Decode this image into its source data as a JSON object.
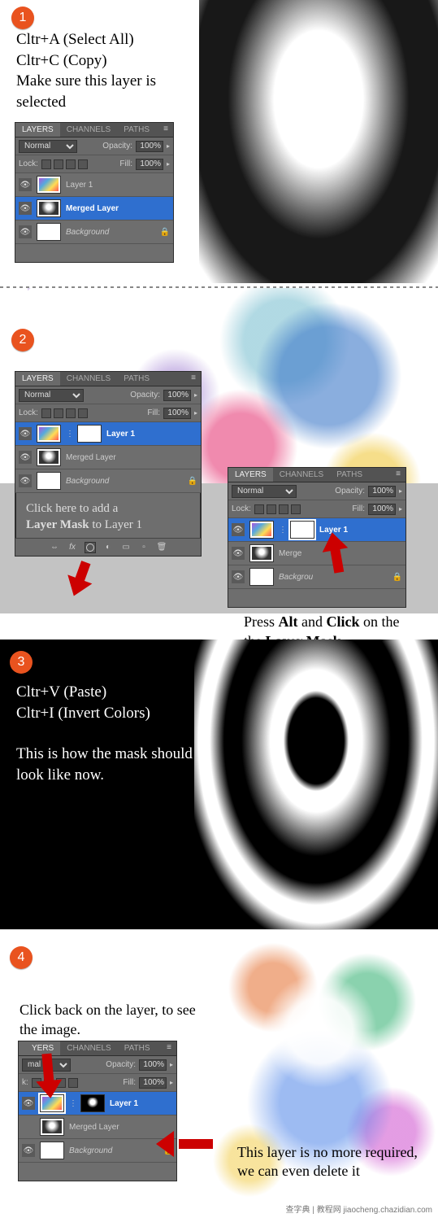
{
  "steps": {
    "s1": {
      "num": "1",
      "line1": "Cltr+A (Select All)",
      "line2": "Cltr+C (Copy)",
      "line3": "Make sure this layer is selected"
    },
    "s2": {
      "num": "2",
      "hintL_l1": "Click here to add a",
      "hintL_l2a": "Layer Mask",
      "hintL_l2b": " to Layer 1",
      "hintR_pre": "Press ",
      "hintR_alt": "Alt",
      "hintR_mid": " and ",
      "hintR_click": "Click",
      "hintR_post": " on the ",
      "hintR_lm": "Layer Mask"
    },
    "s3": {
      "num": "3",
      "line1": "Cltr+V (Paste)",
      "line2": "Cltr+I (Invert Colors)",
      "line3": "This is how the mask should look like now."
    },
    "s4": {
      "num": "4",
      "line1": "Click back on the layer, to see the image.",
      "hint": "This layer is no more required, we can even delete it"
    }
  },
  "panel": {
    "tabs": {
      "layers": "LAYERS",
      "channels": "CHANNELS",
      "paths": "PATHS"
    },
    "blend": "Normal",
    "opacity_label": "Opacity:",
    "opacity_val": "100%",
    "lock_label": "Lock:",
    "fill_label": "Fill:",
    "fill_val": "100%",
    "layer1": "Layer 1",
    "merged": "Merged Layer",
    "background": "Background",
    "lock_icon": "🔒",
    "eye": "👁"
  },
  "watermark": "查字典 | 教程网  jiaocheng.chazidian.com"
}
